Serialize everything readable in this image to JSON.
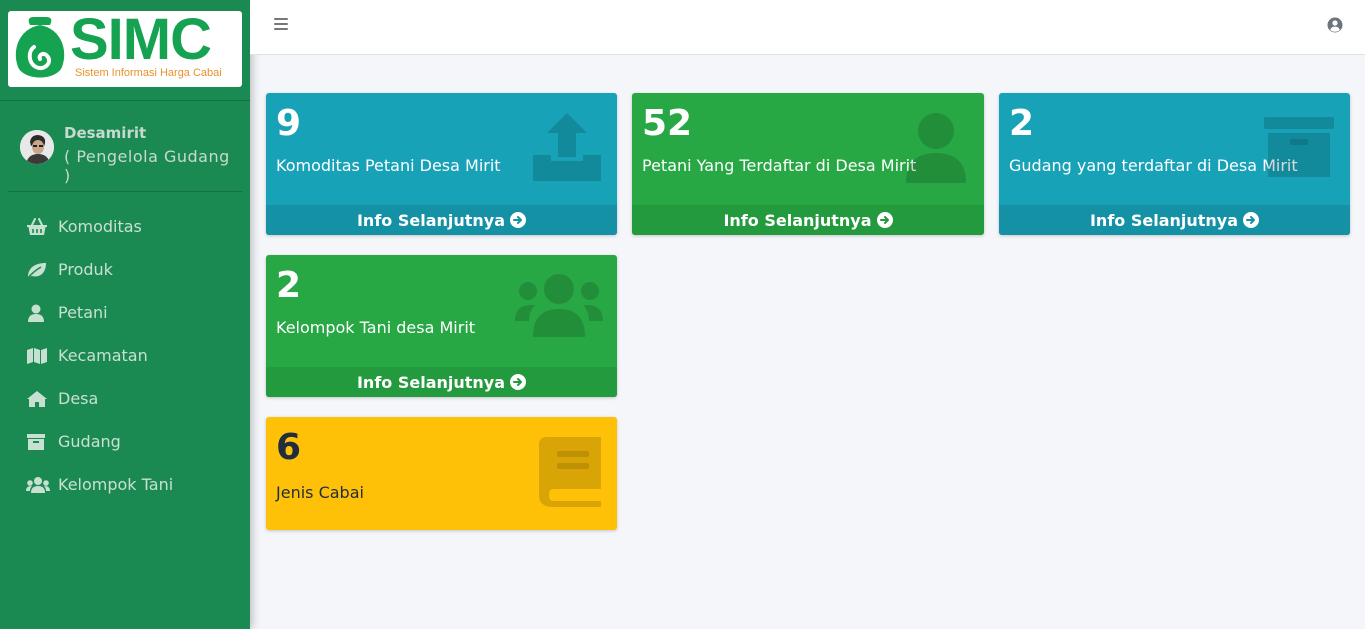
{
  "brand": {
    "logo_text": "SIMC",
    "tagline": "Sistem Informasi Harga Cabai"
  },
  "user": {
    "name": "Desamirit",
    "role": "( Pengelola Gudang )"
  },
  "sidebar": {
    "items": [
      {
        "label": "Komoditas",
        "icon": "basket-icon"
      },
      {
        "label": "Produk",
        "icon": "leaf-icon"
      },
      {
        "label": "Petani",
        "icon": "user-icon"
      },
      {
        "label": "Kecamatan",
        "icon": "map-icon"
      },
      {
        "label": "Desa",
        "icon": "home-icon"
      },
      {
        "label": "Gudang",
        "icon": "archive-icon"
      },
      {
        "label": "Kelompok Tani",
        "icon": "users-icon"
      }
    ]
  },
  "header": {
    "menu_icon": "hamburger-icon",
    "user_icon": "user-circle-icon"
  },
  "cards": [
    {
      "count": "9",
      "label": "Komoditas Petani Desa Mirit",
      "link": "Info Selanjutnya",
      "icon": "upload-icon",
      "color": "#17a2b8"
    },
    {
      "count": "52",
      "label": "Petani Yang Terdaftar di Desa Mirit",
      "link": "Info Selanjutnya",
      "icon": "user-icon",
      "color": "#28a745"
    },
    {
      "count": "2",
      "label": "Gudang yang terdaftar di Desa Mirit",
      "link": "Info Selanjutnya",
      "icon": "archive-icon",
      "color": "#17a2b8"
    },
    {
      "count": "2",
      "label": "Kelompok Tani desa Mirit",
      "link": "Info Selanjutnya",
      "icon": "users-icon",
      "color": "#28a745"
    },
    {
      "count": "6",
      "label": "Jenis Cabai",
      "icon": "book-icon",
      "color": "#ffc107"
    }
  ],
  "colors": {
    "sidebar": "#1a8a52",
    "accent_green": "#28a745",
    "accent_teal": "#17a2b8",
    "accent_yellow": "#ffc107"
  }
}
